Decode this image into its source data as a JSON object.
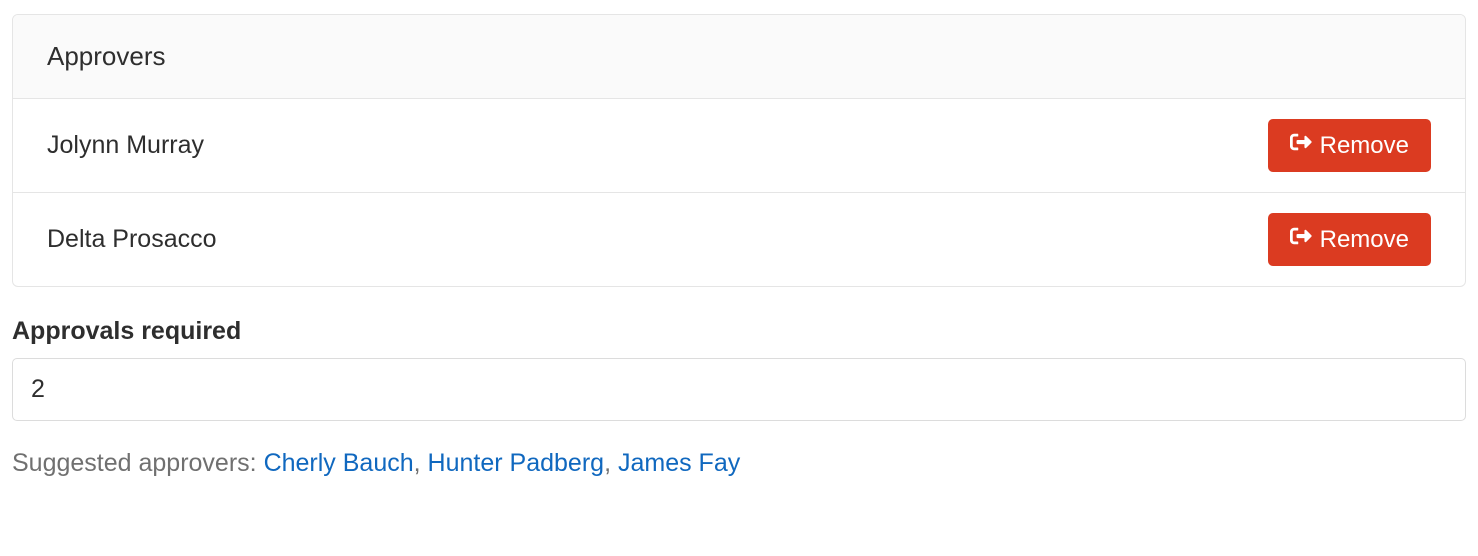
{
  "approvers_panel": {
    "header": "Approvers",
    "rows": [
      {
        "name": "Jolynn Murray"
      },
      {
        "name": "Delta Prosacco"
      }
    ],
    "remove_label": "Remove"
  },
  "approvals_required": {
    "label": "Approvals required",
    "value": "2"
  },
  "suggested": {
    "prefix": "Suggested approvers: ",
    "items": [
      "Cherly Bauch",
      "Hunter Padberg",
      "James Fay"
    ]
  }
}
